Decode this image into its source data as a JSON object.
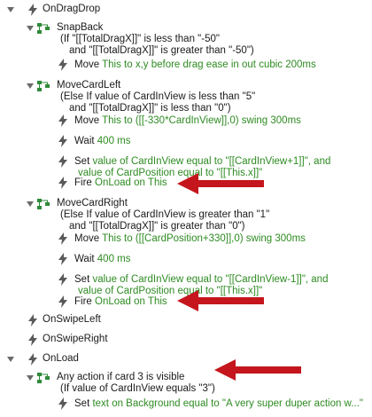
{
  "events": [
    {
      "name": "OnDragDrop",
      "cases": [
        {
          "name": "SnapBack",
          "condition": [
            "(If \"[[TotalDragX]]\" is less than \"-50\"",
            "and \"[[TotalDragX]]\" is greater than \"-50\")"
          ],
          "actions": [
            {
              "verb": "Move",
              "detail": "This to x,y before drag ease in out cubic 200ms"
            }
          ]
        },
        {
          "name": "MoveCardLeft",
          "condition": [
            "(Else If value of CardInView is less than \"5\"",
            "and \"[[TotalDragX]]\" is less than \"0\")"
          ],
          "actions": [
            {
              "verb": "Move",
              "detail": "This to ([[-330*CardInView]],0) swing 300ms"
            },
            {
              "verb": "Wait",
              "detail": "400 ms"
            },
            {
              "verb": "Set",
              "detail": "value of CardInView equal to \"[[CardInView+1]]\", and",
              "detail2": "value of CardPosition equal to \"[[This.x]]\""
            },
            {
              "verb": "Fire",
              "detail": "OnLoad on This"
            }
          ]
        },
        {
          "name": "MoveCardRight",
          "condition": [
            "(Else If value of CardInView is greater than \"1\"",
            "and \"[[TotalDragX]]\" is greater than \"0\")"
          ],
          "actions": [
            {
              "verb": "Move",
              "detail": "This to ([[CardPosition+330]],0) swing 300ms"
            },
            {
              "verb": "Wait",
              "detail": "400 ms"
            },
            {
              "verb": "Set",
              "detail": "value of CardInView equal to \"[[CardInView-1]]\", and",
              "detail2": "value of CardPosition equal to \"[[This.x]]\""
            },
            {
              "verb": "Fire",
              "detail": "OnLoad on This"
            }
          ]
        }
      ]
    },
    {
      "name": "OnSwipeLeft"
    },
    {
      "name": "OnSwipeRight"
    },
    {
      "name": "OnLoad",
      "cases": [
        {
          "name": "Any action if card 3 is visible",
          "condition": [
            "(If value of CardInView equals \"3\")"
          ],
          "actions": [
            {
              "verb": "Set",
              "detail": "text on Background equal to \"A very super duper action w...\""
            }
          ]
        }
      ]
    }
  ],
  "colors": {
    "action_detail": "#2e8b22",
    "arrow": "#c4161c",
    "case_icon": "#2f8a3a",
    "lightning": "#5a5a5a"
  },
  "icons": {
    "event": "lightning-icon",
    "case": "case-flow-icon",
    "action": "action-lightning-icon"
  }
}
